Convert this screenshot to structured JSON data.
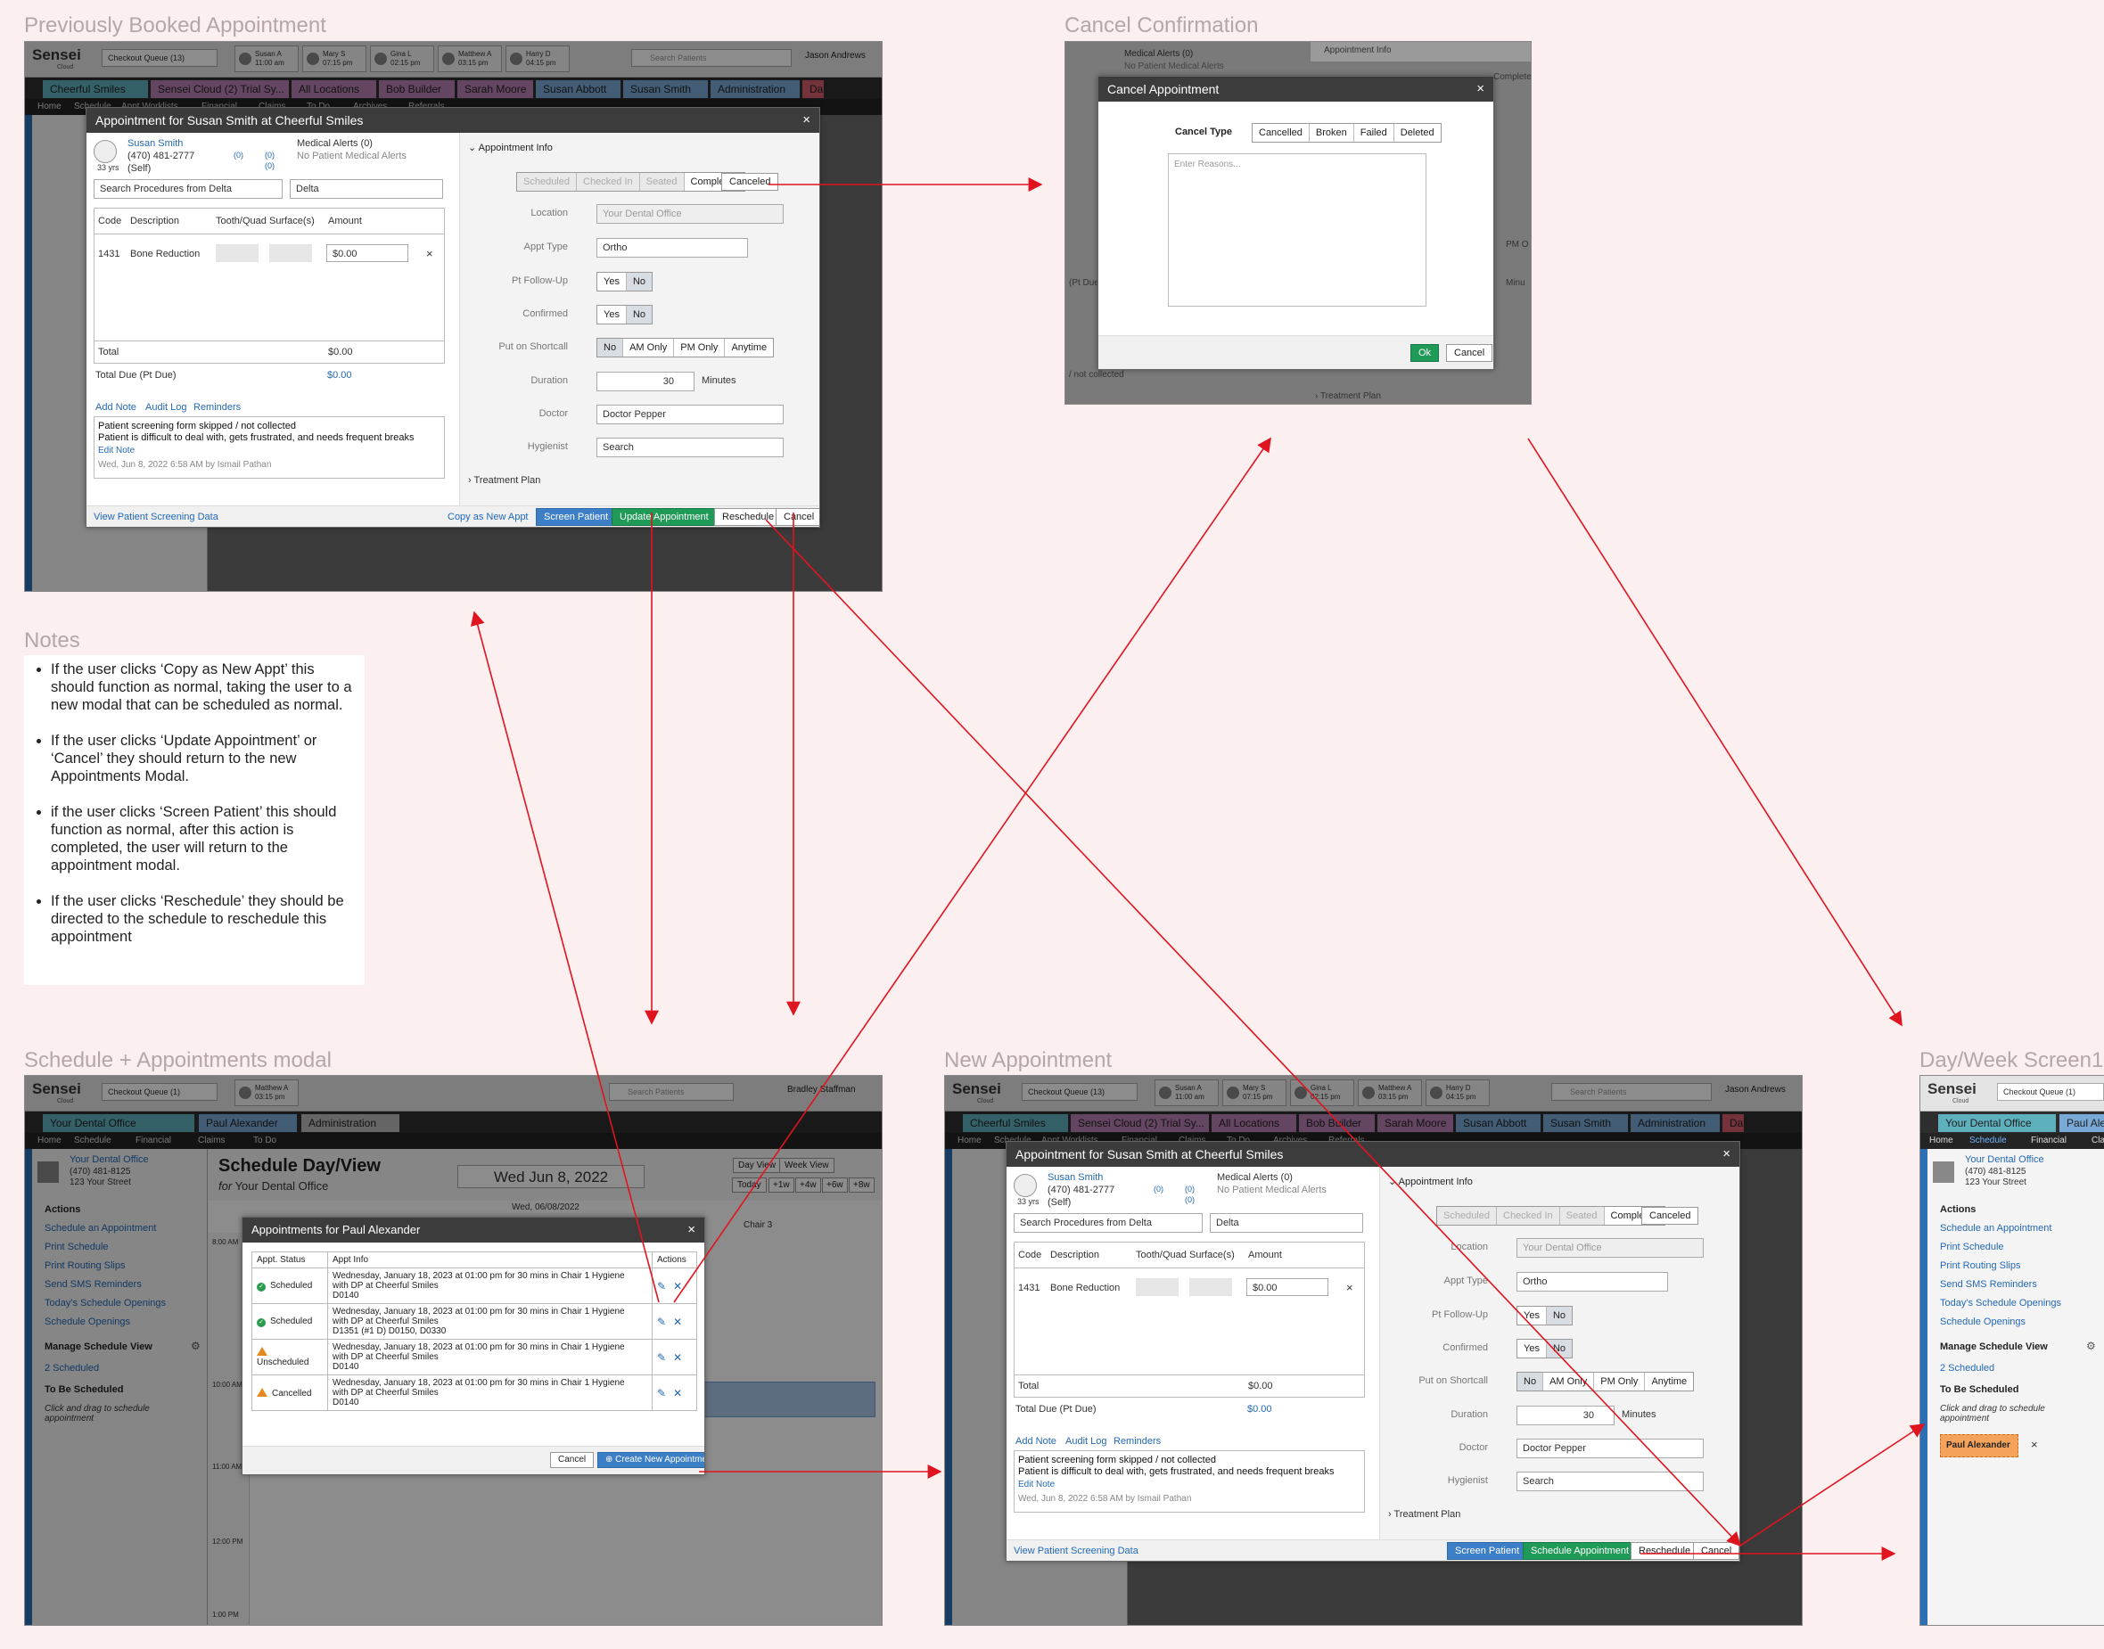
{
  "titles": {
    "previously_booked": "Previously Booked Appointment",
    "cancel_confirmation": "Cancel Confirmation",
    "notes": "Notes",
    "schedule_appointments_modal": "Schedule + Appointments modal",
    "new_appointment": "New Appointment",
    "day_week": "Day/Week Screen1"
  },
  "notes": [
    "If the user clicks ‘Copy as New Appt’ this should function as normal, taking the user to a new modal that can be scheduled as normal.",
    "If the user clicks ‘Update Appointment’ or ‘Cancel’ they should return to the new Appointments Modal.",
    "if the user clicks ‘Screen Patient’ this should function as normal, after this action is completed, the user will return to the appointment modal.",
    "If the user clicks ‘Reschedule’ they should be directed to the schedule to reschedule this appointment"
  ],
  "app": {
    "logo": "Sensei",
    "logo_sub": "Cloud",
    "checkout_queue": "Checkout Queue (13)",
    "checkout_queue_1": "Checkout Queue (1)",
    "search_placeholder": "Search Patients",
    "user_jason": "Jason Andrews",
    "user_bradley": "Bradley Staffman",
    "queue_patients": [
      {
        "name": "Susan A",
        "time": "11:00 am"
      },
      {
        "name": "Mary S",
        "time": "07:15 pm"
      },
      {
        "name": "Gina L",
        "time": "02:15 pm"
      },
      {
        "name": "Matthew A",
        "time": "03:15 pm"
      },
      {
        "name": "Harry D",
        "time": "04:15 pm"
      }
    ],
    "queue_patient_single": {
      "name": "Matthew A",
      "time": "03:15 pm"
    },
    "tabs_main": [
      "Cheerful Smiles",
      "Sensei Cloud (2) Trial Sy...",
      "All Locations",
      "Bob Builder",
      "Sarah Moore",
      "Susan Abbott",
      "Susan Smith",
      "Administration",
      "Da"
    ],
    "tabs_schedule": [
      "Your Dental Office",
      "Paul Alexander",
      "Administration"
    ],
    "nav": [
      "Home",
      "Schedule",
      "Appt Worklists",
      "Financial",
      "Claims",
      "To Do",
      "Archives",
      "Referrals"
    ],
    "nav_short": [
      "Home",
      "Schedule",
      "Financial",
      "Claims",
      "To Do"
    ]
  },
  "office": {
    "name": "Your Dental Office",
    "phone": "(470) 481-8125",
    "street": "123 Your Street"
  },
  "sidebar": {
    "actions_head": "Actions",
    "actions": [
      "Schedule an Appointment",
      "Print Schedule",
      "Print Routing Slips",
      "Send SMS Reminders",
      "Today's Schedule Openings",
      "Schedule Openings"
    ],
    "manage_head": "Manage Schedule View",
    "scheduled": "2 Scheduled",
    "to_be_scheduled": "To Be Scheduled",
    "drag_hint": "Click and drag to schedule appointment",
    "chip": "Paul Alexander"
  },
  "appt_modal": {
    "title": "Appointment for Susan Smith at Cheerful Smiles",
    "patient_name": "Susan Smith",
    "patient_phone": "(470) 481-2777",
    "patient_age": "33 yrs",
    "patient_rel": "(Self)",
    "badge_counts": [
      "(0)",
      "(0)",
      "(0)"
    ],
    "medical_alerts": "Medical Alerts (0)",
    "no_alerts": "No Patient Medical Alerts",
    "search_procedures": "Search Procedures from Delta",
    "delta": "Delta",
    "columns": [
      "Code",
      "Description",
      "Tooth/Quad",
      "Surface(s)",
      "Amount"
    ],
    "row": {
      "code": "1431",
      "description": "Bone Reduction",
      "amount": "$0.00"
    },
    "total_label": "Total",
    "total_value": "$0.00",
    "total_due_label": "Total Due (Pt Due)",
    "total_due_value": "$0.00",
    "note_links": [
      "Add Note",
      "Audit Log",
      "Reminders"
    ],
    "note_line1": "Patient screening form skipped / not collected",
    "note_line2": "Patient is difficult to deal with, gets frustrated, and needs frequent breaks",
    "edit_note": "Edit Note",
    "note_meta": "Wed, Jun 8, 2022 6:58 AM by Ismail Pathan",
    "appt_info": "Appointment Info",
    "statuses": [
      "Scheduled",
      "Checked In",
      "Seated",
      "Completed"
    ],
    "canceled": "Canceled",
    "labels": {
      "location": "Location",
      "appt_type": "Appt Type",
      "follow_up": "Pt Follow-Up",
      "confirmed": "Confirmed",
      "shortcall": "Put on Shortcall",
      "duration": "Duration",
      "doctor": "Doctor",
      "hygienist": "Hygienist"
    },
    "location_value": "Your Dental Office",
    "appt_type_value": "Ortho",
    "yes": "Yes",
    "no": "No",
    "shortcall_opts": [
      "No",
      "AM Only",
      "PM Only",
      "Anytime"
    ],
    "duration_value": "30",
    "minutes": "Minutes",
    "doctor_value": "Doctor Pepper",
    "hygienist_value": "Search",
    "treatment_plan": "Treatment Plan",
    "view_screening": "View Patient Screening Data",
    "copy_new": "Copy as New Appt",
    "screen_patient": "Screen Patient",
    "update_appt": "Update Appointment",
    "schedule_appt": "Schedule Appointment",
    "reschedule": "Reschedule",
    "cancel": "Cancel"
  },
  "cancel_modal": {
    "title": "Cancel Appointment",
    "cancel_type": "Cancel Type",
    "options": [
      "Cancelled",
      "Broken",
      "Failed",
      "Deleted"
    ],
    "reasons_placeholder": "Enter Reasons...",
    "ok": "Ok",
    "cancel": "Cancel",
    "bg_alerts": "Medical Alerts (0)",
    "bg_no_alerts": "No Patient Medical Alerts",
    "bg_appt_info": "Appointment Info",
    "bg_treatment": "Treatment Plan",
    "bg_complete": "Complete",
    "bg_pt_due": "(Pt Due)",
    "bg_minu": "Minu",
    "bg_pm_o": "PM O",
    "bg_not_collected": "/ not collected",
    "bg_collected": "collected"
  },
  "schedule": {
    "title": "Schedule Day/View",
    "for": "for",
    "office": "Your Dental Office",
    "date": "Wed Jun 8, 2022",
    "day_view": "Day View",
    "week_view": "Week View",
    "today": "Today",
    "jumps": [
      "+1w",
      "+4w",
      "+6w",
      "+8w"
    ],
    "col_date": "Wed, 06/08/2022",
    "chair3": "Chair 3",
    "times": [
      "8:00 AM",
      "10:00 AM",
      "11:00 AM",
      "12:00 PM",
      "1:00 PM"
    ],
    "block_label": "ee"
  },
  "appts_modal": {
    "title": "Appointments for Paul Alexander",
    "columns": [
      "Appt. Status",
      "Appt Info",
      "Actions"
    ],
    "rows": [
      {
        "status": "Scheduled",
        "icon": "check",
        "line1": "Wednesday, January 18, 2023 at 01:00 pm for 30 mins in Chair 1 Hygiene",
        "line2": "with DP at Cheerful Smiles",
        "line3": "D0140"
      },
      {
        "status": "Scheduled",
        "icon": "check",
        "line1": "Wednesday, January 18, 2023 at 01:00 pm for 30 mins in Chair 1 Hygiene",
        "line2": "with DP at Cheerful Smiles",
        "line3": "D1351 (#1 D) D0150, D0330"
      },
      {
        "status": "Unscheduled",
        "icon": "warn",
        "line1": "Wednesday, January 18, 2023 at 01:00 pm for 30 mins in Chair 1 Hygiene",
        "line2": "with DP at Cheerful Smiles",
        "line3": "D0140"
      },
      {
        "status": "Cancelled",
        "icon": "warn",
        "line1": "Wednesday, January 18, 2023 at 01:00 pm for 30 mins in Chair 1 Hygiene",
        "line2": "with DP at Cheerful Smiles",
        "line3": "D0140"
      }
    ],
    "cancel": "Cancel",
    "create": "Create New Appointment"
  },
  "colors": {
    "accent_blue": "#2368b5",
    "green": "#1f9a57",
    "arrow_red": "#e0141e",
    "chip_orange": "#f5a35b"
  }
}
